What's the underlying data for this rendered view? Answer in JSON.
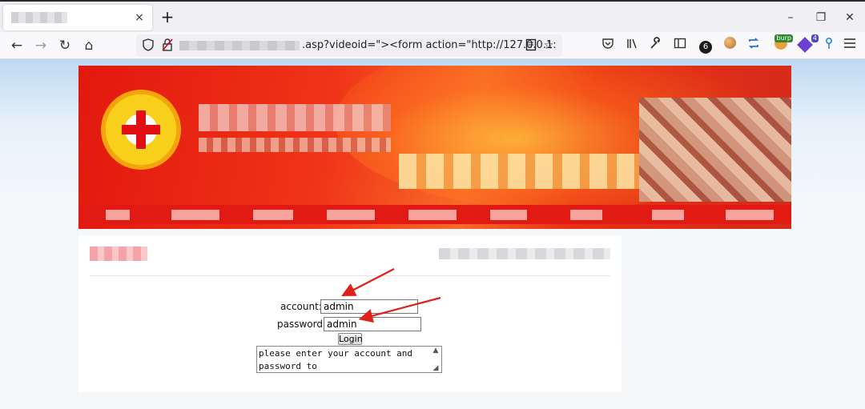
{
  "browser": {
    "tab_close": "×",
    "new_tab": "+",
    "window_controls": {
      "minimize": "–",
      "restore": "❐",
      "close": "✕"
    },
    "nav": {
      "back": "←",
      "forward": "→",
      "reload": "↻",
      "home": "⌂"
    },
    "url_visible_text": ".asp?videoid=\"><form action=\"http://127.0.0.1:",
    "toolbar": {
      "counter_badge": "6",
      "burp_label": "burp",
      "ext_badge": "4"
    }
  },
  "page": {
    "form": {
      "account_label": "account:",
      "account_value": "admin",
      "password_label": "password:",
      "password_value": "admin",
      "login_button": "Login",
      "message": "please enter your account and password to"
    }
  },
  "colors": {
    "banner_red": "#e2180e",
    "arrow_red": "#e0201a",
    "page_bg": "#f5f6f8"
  }
}
